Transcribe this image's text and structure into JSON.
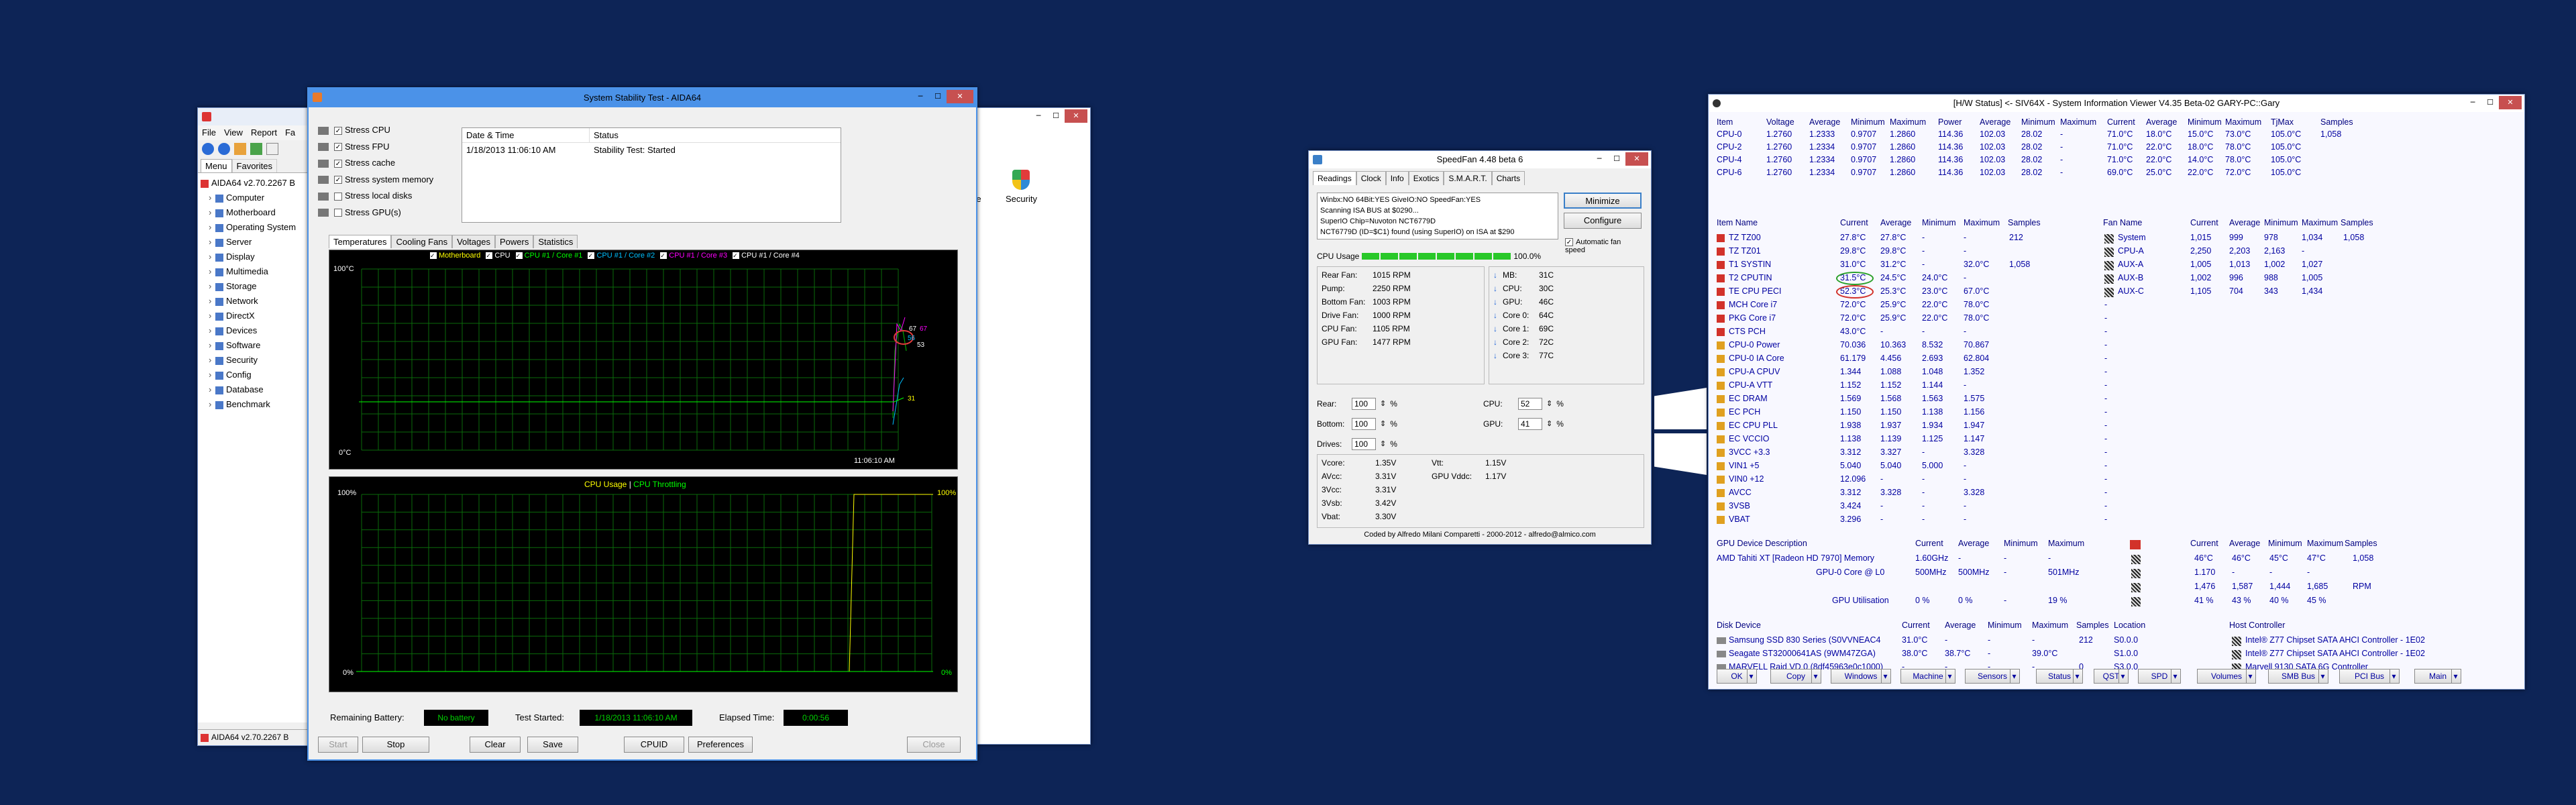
{
  "aida_main": {
    "menu": [
      "File",
      "View",
      "Report",
      "Fa"
    ],
    "tabs": [
      "Menu",
      "Favorites"
    ],
    "root": "AIDA64 v2.70.2267 B",
    "items": [
      "Computer",
      "Motherboard",
      "Operating System",
      "Server",
      "Display",
      "Multimedia",
      "Storage",
      "Network",
      "DirectX",
      "Devices",
      "Software",
      "Security",
      "Config",
      "Database",
      "Benchmark"
    ],
    "status": "AIDA64 v2.70.2267 B"
  },
  "bg_window": {
    "icon_label": "Security"
  },
  "stability": {
    "title": "System Stability Test - AIDA64",
    "checks": [
      {
        "label": "Stress CPU",
        "on": true
      },
      {
        "label": "Stress FPU",
        "on": true
      },
      {
        "label": "Stress cache",
        "on": true
      },
      {
        "label": "Stress system memory",
        "on": true
      },
      {
        "label": "Stress local disks",
        "on": false
      },
      {
        "label": "Stress GPU(s)",
        "on": false
      }
    ],
    "log_headers": [
      "Date & Time",
      "Status"
    ],
    "log_row": [
      "1/18/2013 11:06:10 AM",
      "Stability Test: Started"
    ],
    "tabs": [
      "Temperatures",
      "Cooling Fans",
      "Voltages",
      "Powers",
      "Statistics"
    ],
    "legend": [
      "Motherboard",
      "CPU",
      "CPU #1 / Core #1",
      "CPU #1 / Core #2",
      "CPU #1 / Core #3",
      "CPU #1 / Core #4"
    ],
    "legend_colors": [
      "#ffff00",
      "#ffffff",
      "#00ff00",
      "#00c0ff",
      "#ff00ff",
      "#ffffff"
    ],
    "temp_top": "100°C",
    "temp_bot": "0°C",
    "temp_time": "11:06:10 AM",
    "temp_vals": [
      "67",
      "67",
      "56",
      "53",
      "31"
    ],
    "usage_title": "CPU Usage",
    "usage_sep": " | ",
    "throttle_title": "CPU Throttling",
    "usage_top_l": "100%",
    "usage_bot_l": "0%",
    "usage_top_r": "100%",
    "usage_bot_r": "0%",
    "rem_label": "Remaining Battery:",
    "rem_val": "No battery",
    "started_label": "Test Started:",
    "started_val": "1/18/2013 11:06:10 AM",
    "elapsed_label": "Elapsed Time:",
    "elapsed_val": "0:00:56",
    "buttons": [
      "Start",
      "Stop",
      "Clear",
      "Save",
      "CPUID",
      "Preferences",
      "Close"
    ]
  },
  "speedfan": {
    "title": "SpeedFan 4.48 beta 6",
    "tabs": [
      "Readings",
      "Clock",
      "Info",
      "Exotics",
      "S.M.A.R.T.",
      "Charts"
    ],
    "log": [
      "Winbx:NO 64Bit:YES GiveIO:NO SpeedFan:YES",
      "Scanning ISA BUS at $0290...",
      "SuperIO Chip=Nuvoton NCT6779D",
      "NCT6779D (ID=$C1) found (using SuperIO) on ISA at $290"
    ],
    "btn_min": "Minimize",
    "btn_conf": "Configure",
    "auto_fan": "Automatic fan speed",
    "cpu_usage_label": "CPU Usage",
    "cpu_usage_val": "100.0%",
    "fans": [
      [
        "Rear Fan:",
        "1015 RPM"
      ],
      [
        "Pump:",
        "2250 RPM"
      ],
      [
        "Bottom Fan:",
        "1003 RPM"
      ],
      [
        "Drive Fan:",
        "1000 RPM"
      ],
      [
        "CPU Fan:",
        "1105 RPM"
      ],
      [
        "GPU Fan:",
        "1477 RPM"
      ]
    ],
    "temps": [
      [
        "MB:",
        "31C"
      ],
      [
        "CPU:",
        "30C"
      ],
      [
        "GPU:",
        "46C"
      ],
      [
        "Core 0:",
        "64C"
      ],
      [
        "Core 1:",
        "69C"
      ],
      [
        "Core 2:",
        "72C"
      ],
      [
        "Core 3:",
        "77C"
      ]
    ],
    "speeds": [
      [
        "Rear:",
        "100",
        "%"
      ],
      [
        "Bottom:",
        "100",
        "%"
      ],
      [
        "Drives:",
        "100",
        "%"
      ]
    ],
    "speeds2": [
      [
        "CPU:",
        "52",
        "%"
      ],
      [
        "GPU:",
        "41",
        "%"
      ]
    ],
    "volts": [
      [
        "Vcore:",
        "1.35V"
      ],
      [
        "AVcc:",
        "3.31V"
      ],
      [
        "3Vcc:",
        "3.31V"
      ],
      [
        "3Vsb:",
        "3.42V"
      ],
      [
        "Vbat:",
        "3.30V"
      ]
    ],
    "volts2": [
      [
        "Vtt:",
        "1.15V"
      ],
      [
        "GPU Vddc:",
        "1.17V"
      ]
    ],
    "footer": "Coded by Alfredo Milani Comparetti - 2000-2012 - alfredo@almico.com"
  },
  "siv": {
    "title": "[H/W Status] <- SIV64X - System Information Viewer V4.35 Beta-02 GARY-PC::Gary",
    "cpu_header": [
      "Item",
      "Voltage",
      "Average",
      "Minimum",
      "Maximum",
      "Power",
      "Average",
      "Minimum",
      "Maximum",
      "Current",
      "Average",
      "Minimum",
      "Maximum",
      "TjMax",
      "Samples"
    ],
    "cpu_rows": [
      [
        "CPU-0",
        "1.2760",
        "1.2333",
        "0.9707",
        "1.2860",
        "114.36",
        "102.03",
        "28.02",
        "-",
        "71.0°C",
        "18.0°C",
        "15.0°C",
        "73.0°C",
        "105.0°C",
        "1,058"
      ],
      [
        "CPU-2",
        "1.2760",
        "1.2334",
        "0.9707",
        "1.2860",
        "114.36",
        "102.03",
        "28.02",
        "-",
        "71.0°C",
        "22.0°C",
        "18.0°C",
        "78.0°C",
        "105.0°C",
        ""
      ],
      [
        "CPU-4",
        "1.2760",
        "1.2334",
        "0.9707",
        "1.2860",
        "114.36",
        "102.03",
        "28.02",
        "-",
        "71.0°C",
        "22.0°C",
        "14.0°C",
        "78.0°C",
        "105.0°C",
        ""
      ],
      [
        "CPU-6",
        "1.2760",
        "1.2334",
        "0.9707",
        "1.2860",
        "114.36",
        "102.03",
        "28.02",
        "-",
        "69.0°C",
        "25.0°C",
        "22.0°C",
        "72.0°C",
        "105.0°C",
        ""
      ]
    ],
    "sens_header": [
      "Item Name",
      "Current",
      "Average",
      "Minimum",
      "Maximum",
      "Samples"
    ],
    "sens_rows": [
      [
        "TZ TZ00",
        "27.8°C",
        "27.8°C",
        "-",
        "-",
        "212"
      ],
      [
        "TZ TZ01",
        "29.8°C",
        "29.8°C",
        "-",
        "-",
        ""
      ],
      [
        "T1 SYSTIN",
        "31.0°C",
        "31.2°C",
        "-",
        "32.0°C",
        "1,058"
      ],
      [
        "T2 CPUTIN",
        "31.5°C",
        "24.5°C",
        "24.0°C",
        "-",
        ""
      ],
      [
        "TE CPU PECI",
        "52.3°C",
        "25.3°C",
        "23.0°C",
        "67.0°C",
        ""
      ],
      [
        "MCH Core i7",
        "72.0°C",
        "25.9°C",
        "22.0°C",
        "78.0°C",
        ""
      ],
      [
        "PKG Core i7",
        "72.0°C",
        "25.9°C",
        "22.0°C",
        "78.0°C",
        ""
      ],
      [
        "CTS PCH",
        "43.0°C",
        "-",
        "-",
        "-",
        ""
      ],
      [
        "CPU-0 Power",
        "70.036",
        "10.363",
        "8.532",
        "70.867",
        ""
      ],
      [
        "CPU-0 IA Core",
        "61.179",
        "4.456",
        "2.693",
        "62.804",
        ""
      ],
      [
        "CPU-A CPUV",
        "1.344",
        "1.088",
        "1.048",
        "1.352",
        ""
      ],
      [
        "CPU-A VTT",
        "1.152",
        "1.152",
        "1.144",
        "-",
        ""
      ],
      [
        "EC DRAM",
        "1.569",
        "1.568",
        "1.563",
        "1.575",
        ""
      ],
      [
        "EC PCH",
        "1.150",
        "1.150",
        "1.138",
        "1.156",
        ""
      ],
      [
        "EC CPU PLL",
        "1.938",
        "1.937",
        "1.934",
        "1.947",
        ""
      ],
      [
        "EC VCCIO",
        "1.138",
        "1.139",
        "1.125",
        "1.147",
        ""
      ],
      [
        "3VCC +3.3",
        "3.312",
        "3.327",
        "-",
        "3.328",
        ""
      ],
      [
        "VIN1 +5",
        "5.040",
        "5.040",
        "5.000",
        "-",
        ""
      ],
      [
        "VIN0 +12",
        "12.096",
        "-",
        "-",
        "-",
        ""
      ],
      [
        "AVCC",
        "3.312",
        "3.328",
        "-",
        "3.328",
        ""
      ],
      [
        "3VSB",
        "3.424",
        "-",
        "-",
        "-",
        ""
      ],
      [
        "VBAT",
        "3.296",
        "-",
        "-",
        "-",
        ""
      ]
    ],
    "fan_header": [
      "Fan Name",
      "Current",
      "Average",
      "Minimum",
      "Maximum",
      "Samples"
    ],
    "fan_rows": [
      [
        "System",
        "1,015",
        "999",
        "978",
        "1,034",
        "1,058"
      ],
      [
        "CPU-A",
        "2,250",
        "2,203",
        "2,163",
        "-",
        ""
      ],
      [
        "AUX-A",
        "1,005",
        "1,013",
        "1,002",
        "1,027",
        ""
      ],
      [
        "AUX-B",
        "1,002",
        "996",
        "988",
        "1,005",
        ""
      ],
      [
        "AUX-C",
        "1,105",
        "704",
        "343",
        "1,434",
        ""
      ]
    ],
    "gpu_header": [
      "GPU Device Description",
      "Current",
      "Average",
      "Minimum",
      "Maximum",
      "Current",
      "Average",
      "Minimum",
      "Maximum",
      "Samples"
    ],
    "gpu_rows": [
      [
        "AMD Tahiti XT [Radeon HD 7970] Memory",
        "1.60GHz",
        "-",
        "-",
        "-",
        "46°C",
        "46°C",
        "45°C",
        "47°C",
        "1,058"
      ],
      [
        "GPU-0 Core @ L0",
        "500MHz",
        "500MHz",
        "-",
        "501MHz",
        "1.170",
        "-",
        "-",
        "-",
        ""
      ],
      [
        "",
        "",
        "",
        "",
        "",
        "1,476",
        "1,587",
        "1,444",
        "1,685",
        "RPM"
      ],
      [
        "GPU Utilisation",
        "0 %",
        "0 %",
        "-",
        "19 %",
        "41 %",
        "43 %",
        "40 %",
        "45 %",
        ""
      ]
    ],
    "disk_header": [
      "Disk Device",
      "Current",
      "Average",
      "Minimum",
      "Maximum",
      "Samples",
      "Location",
      "Host Controller"
    ],
    "disk_rows": [
      [
        "Samsung SSD 830 Series (S0VVNEAC4",
        "31.0°C",
        "-",
        "-",
        "-",
        "212",
        "S0.0.0",
        "Intel® Z77 Chipset SATA AHCI Controller - 1E02"
      ],
      [
        "Seagate ST32000641AS (9WM47ZGA)",
        "38.0°C",
        "38.7°C",
        "-",
        "39.0°C",
        "",
        "S1.0.0",
        "Intel® Z77 Chipset SATA AHCI Controller - 1E02"
      ],
      [
        "MARVELL Raid VD 0 (8df45963e0c1000)",
        "-",
        "-",
        "-",
        "-",
        "0",
        "S3.0.0",
        "Marvell 9130 SATA 6G Controller"
      ]
    ],
    "buttons": [
      "OK",
      "Copy",
      "Windows",
      "Machine",
      "Sensors",
      "Status",
      "QST",
      "SPD",
      "Volumes",
      "SMB Bus",
      "PCI Bus",
      "Main"
    ]
  },
  "colors": {
    "desktop": "#0d2456",
    "green": "#00c000",
    "yellow": "#ffff00",
    "lime": "#00ff00"
  }
}
